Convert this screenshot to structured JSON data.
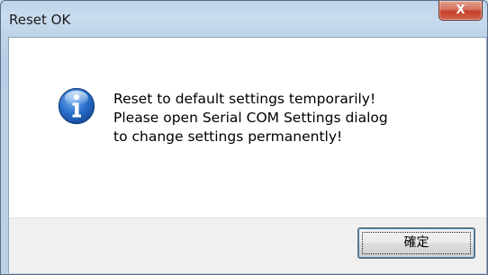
{
  "window": {
    "title": "Reset OK",
    "close_icon": "close-icon",
    "close_glyph": "X"
  },
  "message": {
    "icon": "info-icon",
    "lines": [
      "Reset to default settings temporarily!",
      "Please open Serial COM Settings dialog",
      "to change settings permanently!"
    ]
  },
  "buttons": {
    "ok_label": "確定"
  },
  "colors": {
    "accent": "#3c7fb1",
    "close_red": "#c4402a",
    "info_blue": "#1f5fb8"
  }
}
